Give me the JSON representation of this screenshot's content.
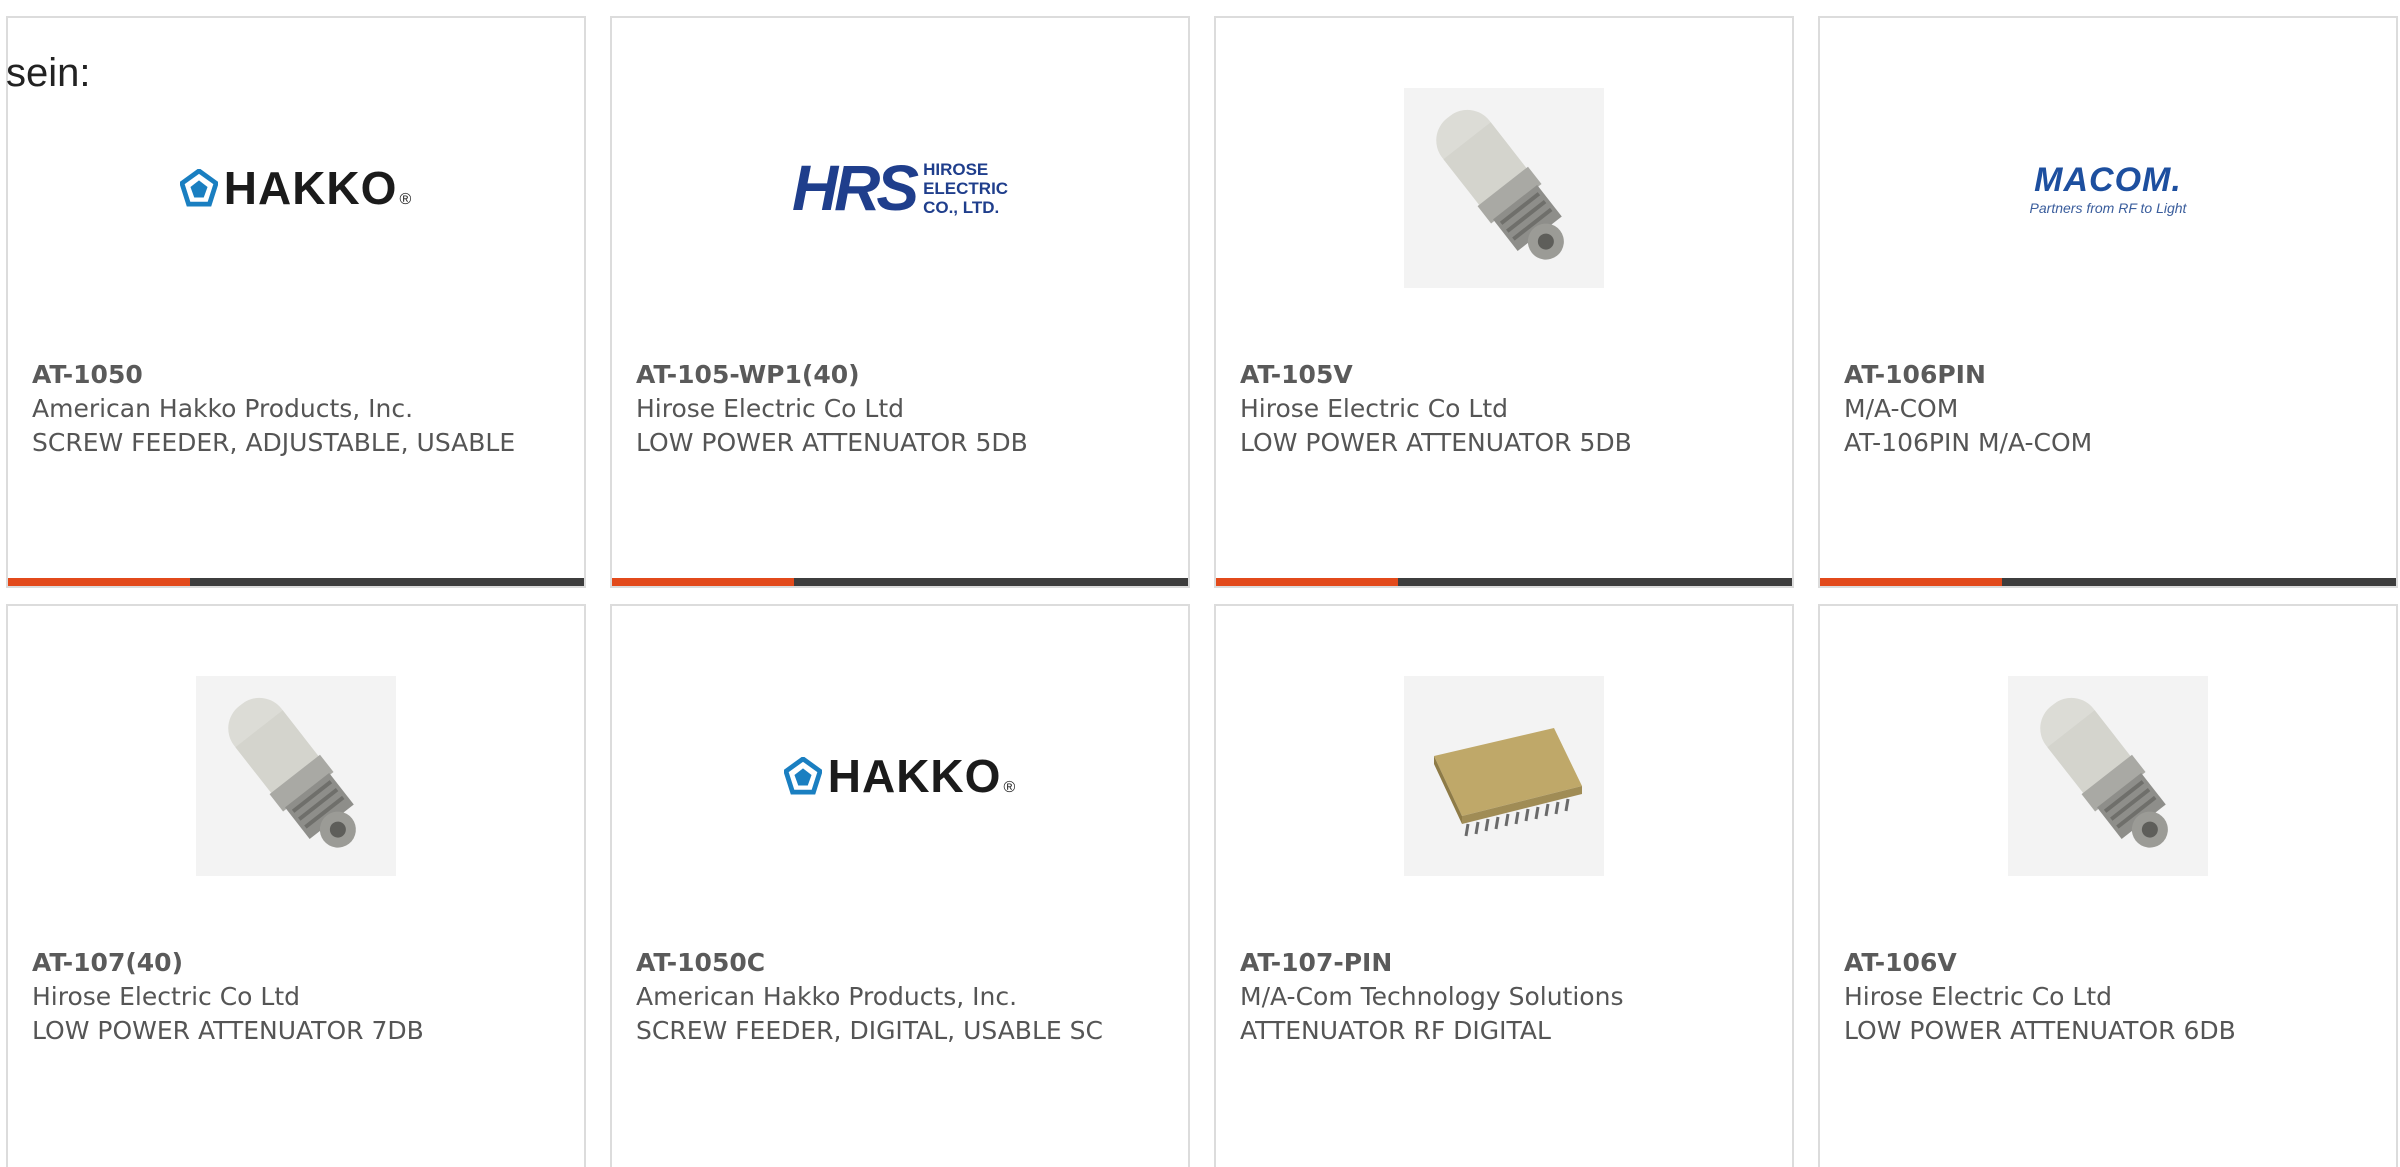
{
  "intro_text": "sein:",
  "products": [
    {
      "part_number": "AT-1050",
      "manufacturer": "American Hakko Products, Inc.",
      "description": "SCREW FEEDER, ADJUSTABLE, USABLE",
      "image": "hakko-logo"
    },
    {
      "part_number": "AT-105-WP1(40)",
      "manufacturer": "Hirose Electric Co Ltd",
      "description": "LOW POWER ATTENUATOR 5DB",
      "image": "hrs-logo",
      "logo_text_big": "HRS",
      "logo_text_small": [
        "HIROSE",
        "ELECTRIC",
        "CO., LTD."
      ]
    },
    {
      "part_number": "AT-105V",
      "manufacturer": "Hirose Electric Co Ltd",
      "description": "LOW POWER ATTENUATOR 5DB",
      "image": "attenuator-photo"
    },
    {
      "part_number": "AT-106PIN",
      "manufacturer": "M/A-COM",
      "description": "AT-106PIN M/A-COM",
      "image": "macom-logo",
      "logo_text_big": "MACOM.",
      "logo_tagline": "Partners from RF to Light"
    },
    {
      "part_number": "AT-107(40)",
      "manufacturer": "Hirose Electric Co Ltd",
      "description": "LOW POWER ATTENUATOR 7DB",
      "image": "attenuator-photo"
    },
    {
      "part_number": "AT-1050C",
      "manufacturer": "American Hakko Products, Inc.",
      "description": "SCREW FEEDER, DIGITAL, USABLE SC",
      "image": "hakko-logo"
    },
    {
      "part_number": "AT-107-PIN",
      "manufacturer": "M/A-Com Technology Solutions",
      "description": "ATTENUATOR RF DIGITAL",
      "image": "chip-photo"
    },
    {
      "part_number": "AT-106V",
      "manufacturer": "Hirose Electric Co Ltd",
      "description": "LOW POWER ATTENUATOR 6DB",
      "image": "attenuator-photo"
    }
  ],
  "hakko_logo_text": "HAKKO",
  "colors": {
    "accent": "#e24a1b",
    "stripe": "#3d3d3d",
    "border": "#dcdcdc",
    "hrs_blue": "#1f3e8c",
    "macom_blue": "#1d4f9f",
    "hakko_blue": "#1a7fc1"
  }
}
